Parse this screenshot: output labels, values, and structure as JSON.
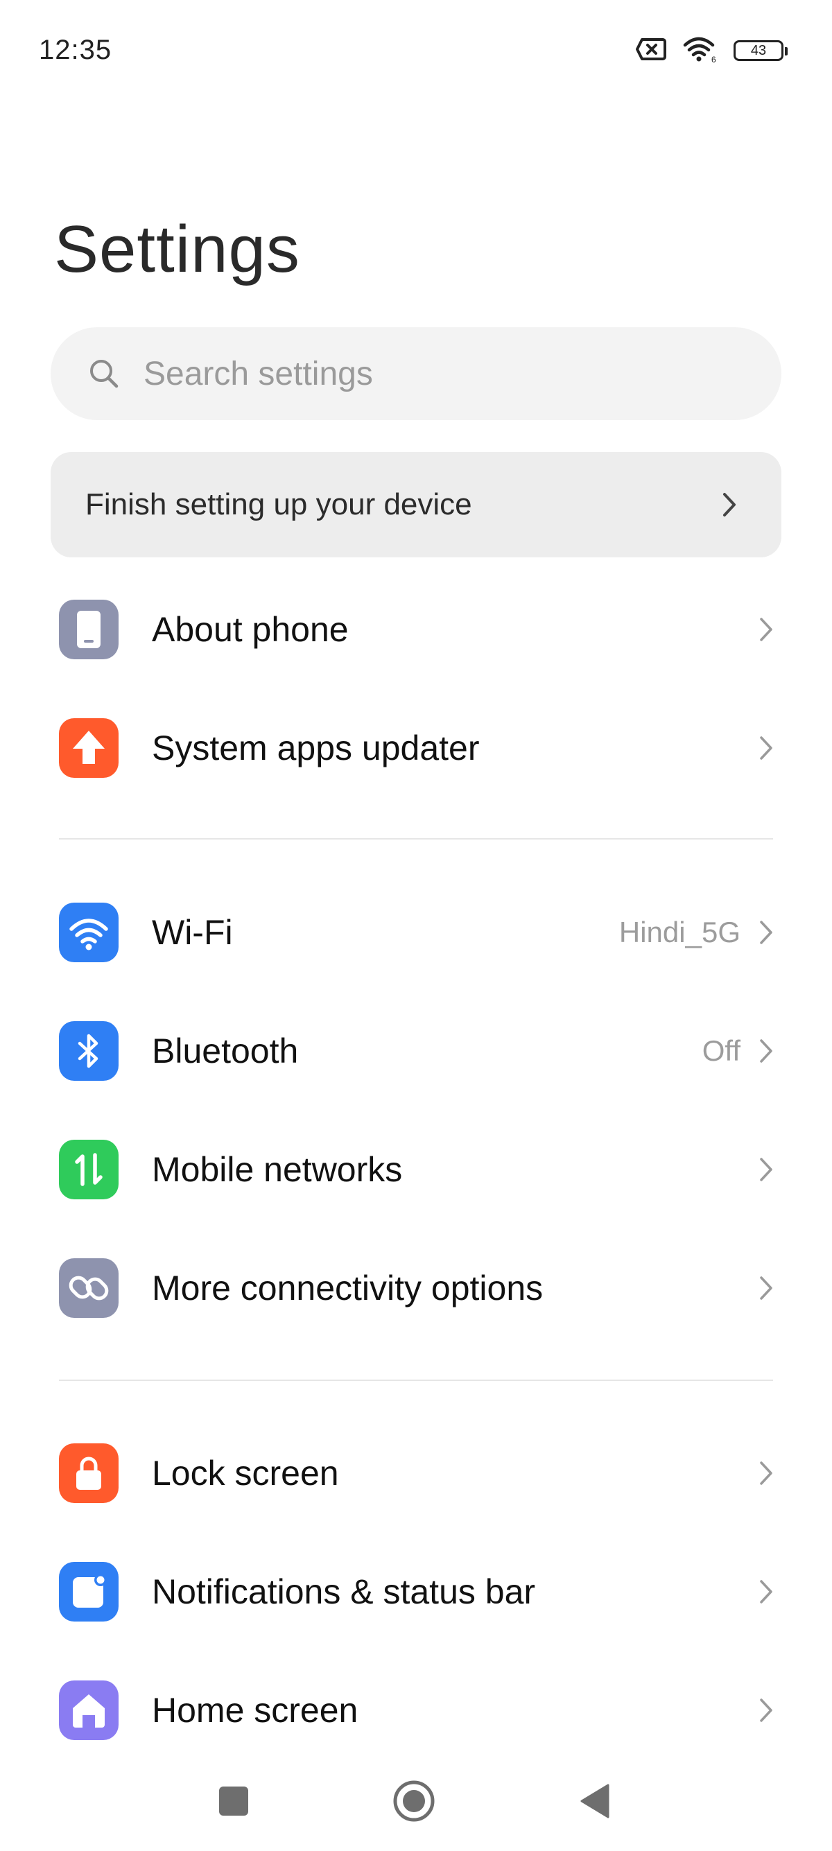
{
  "status_bar": {
    "time": "12:35",
    "battery_level": "43",
    "icons": [
      "sim-off-icon",
      "wifi-icon",
      "battery-icon"
    ]
  },
  "page": {
    "title": "Settings"
  },
  "search": {
    "placeholder": "Search settings",
    "value": ""
  },
  "setup_banner": {
    "label": "Finish setting up your device"
  },
  "groups": [
    {
      "items": [
        {
          "label": "About phone",
          "value": "",
          "icon": "phone-icon",
          "color": "#8E93AE"
        },
        {
          "label": "System apps updater",
          "value": "",
          "icon": "upload-arrow-icon",
          "color": "#FF5A2C"
        }
      ]
    },
    {
      "items": [
        {
          "label": "Wi-Fi",
          "value": "Hindi_5G",
          "icon": "wifi-icon",
          "color": "#2F7FF4"
        },
        {
          "label": "Bluetooth",
          "value": "Off",
          "icon": "bluetooth-icon",
          "color": "#2F7FF4"
        },
        {
          "label": "Mobile networks",
          "value": "",
          "icon": "mobile-data-icon",
          "color": "#2FCB5B"
        },
        {
          "label": "More connectivity options",
          "value": "",
          "icon": "link-icon",
          "color": "#8E93AE"
        }
      ]
    },
    {
      "items": [
        {
          "label": "Lock screen",
          "value": "",
          "icon": "lock-icon",
          "color": "#FF5A2C"
        },
        {
          "label": "Notifications & status bar",
          "value": "",
          "icon": "notification-icon",
          "color": "#2F7FF4"
        },
        {
          "label": "Home screen",
          "value": "",
          "icon": "home-icon",
          "color": "#8A7CF2"
        }
      ]
    }
  ],
  "nav_bar": {
    "buttons": [
      "recents-button",
      "home-button",
      "back-button"
    ]
  }
}
